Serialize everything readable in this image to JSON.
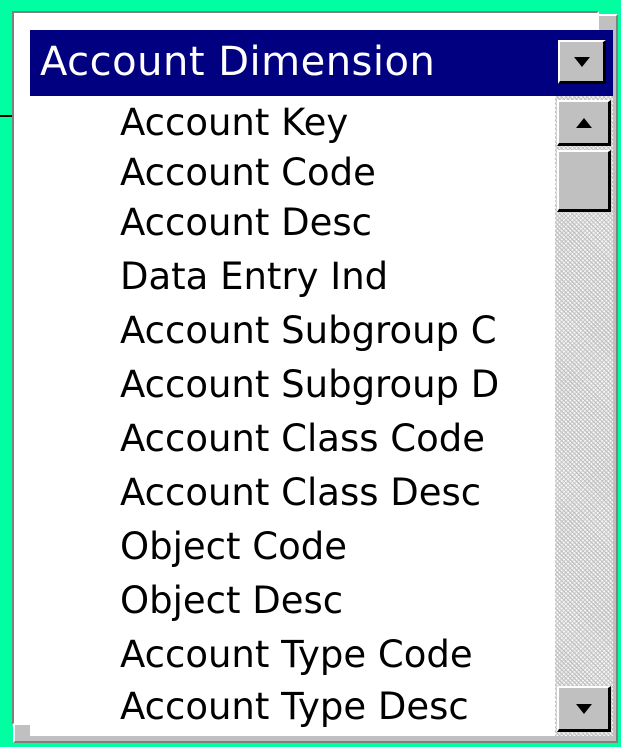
{
  "header": {
    "title": "Account Dimension",
    "dropdown_icon": "chevron-down-icon"
  },
  "list": {
    "items": [
      {
        "label": "Account Key"
      },
      {
        "label": "Account Code"
      },
      {
        "label": "Account Desc"
      },
      {
        "label": "Data Entry Ind"
      },
      {
        "label": "Account Subgroup C"
      },
      {
        "label": "Account Subgroup D"
      },
      {
        "label": "Account Class Code"
      },
      {
        "label": "Account Class Desc"
      },
      {
        "label": "Object Code"
      },
      {
        "label": "Object Desc"
      },
      {
        "label": "Account Type Code"
      },
      {
        "label": "Account Type Desc"
      }
    ]
  },
  "scrollbar": {
    "up_icon": "scroll-up-arrow-icon",
    "down_icon": "scroll-down-arrow-icon",
    "position": 0
  },
  "colors": {
    "header_background": "#000080",
    "header_text": "#ffffff",
    "panel_background": "#c0c0c0",
    "page_border": "#00ffa0"
  }
}
